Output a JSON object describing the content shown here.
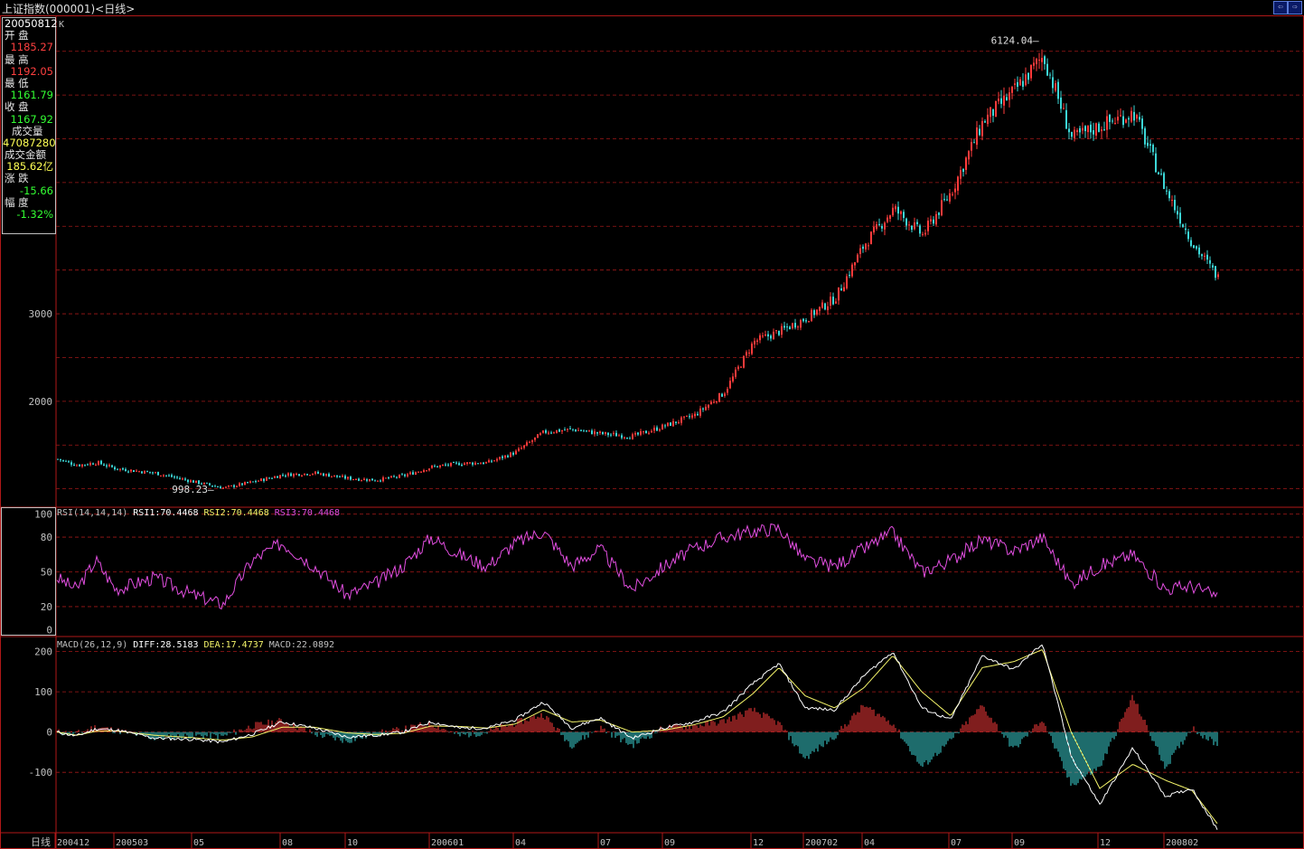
{
  "window": {
    "title": "上证指数(000001)<日线>",
    "buttons": [
      "⇦",
      "⇨"
    ]
  },
  "info": {
    "date": "20050812",
    "rows": [
      {
        "label": "开  盘",
        "value": "1185.27",
        "color": "#ff4040"
      },
      {
        "label": "最  高",
        "value": "1192.05",
        "color": "#ff4040"
      },
      {
        "label": "最  低",
        "value": "1161.79",
        "color": "#33ff33"
      },
      {
        "label": "收  盘",
        "value": "1167.92",
        "color": "#33ff33"
      },
      {
        "label": "成交量",
        "value": "47087280",
        "color": "#ffff55"
      },
      {
        "label": "成交金额",
        "value": "185.62亿",
        "color": "#ffff55"
      },
      {
        "label": "涨  跌",
        "value": "-15.66",
        "color": "#33ff33"
      },
      {
        "label": "幅  度",
        "value": "-1.32%",
        "color": "#33ff33"
      }
    ]
  },
  "colors": {
    "border": "#b01818",
    "grid": "#a01818",
    "up": "#ff3b3b",
    "down": "#3cd7d7",
    "rsi": "#e24ee0",
    "diff": "#ffffff",
    "dea": "#f5f56a",
    "text": "#c0c0c0"
  },
  "chart_data": [
    {
      "type": "candlestick",
      "panel": "main",
      "panel_label": "K",
      "y_ticks": [
        2000,
        3000
      ],
      "ylim": [
        800,
        6400
      ],
      "annotations": [
        {
          "text": "6124.04",
          "value": 6124.04,
          "date": "2007-10"
        },
        {
          "text": "998.23",
          "value": 998.23,
          "date": "2005-06"
        }
      ],
      "close_path": [
        {
          "date": "2004-12",
          "value": 1340
        },
        {
          "date": "2005-01",
          "value": 1270
        },
        {
          "date": "2005-02",
          "value": 1300
        },
        {
          "date": "2005-03",
          "value": 1230
        },
        {
          "date": "2005-04",
          "value": 1180
        },
        {
          "date": "2005-05",
          "value": 1080
        },
        {
          "date": "2005-06",
          "value": 1010
        },
        {
          "date": "2005-07",
          "value": 1080
        },
        {
          "date": "2005-08",
          "value": 1160
        },
        {
          "date": "2005-09",
          "value": 1180
        },
        {
          "date": "2005-10",
          "value": 1120
        },
        {
          "date": "2005-11",
          "value": 1100
        },
        {
          "date": "2005-12",
          "value": 1150
        },
        {
          "date": "2006-01",
          "value": 1250
        },
        {
          "date": "2006-02",
          "value": 1290
        },
        {
          "date": "2006-03",
          "value": 1300
        },
        {
          "date": "2006-04",
          "value": 1420
        },
        {
          "date": "2006-05",
          "value": 1650
        },
        {
          "date": "2006-06",
          "value": 1680
        },
        {
          "date": "2006-07",
          "value": 1630
        },
        {
          "date": "2006-08",
          "value": 1600
        },
        {
          "date": "2006-09",
          "value": 1720
        },
        {
          "date": "2006-10",
          "value": 1840
        },
        {
          "date": "2006-11",
          "value": 2100
        },
        {
          "date": "2006-12",
          "value": 2680
        },
        {
          "date": "2007-01",
          "value": 2800
        },
        {
          "date": "2007-02",
          "value": 2950
        },
        {
          "date": "2007-03",
          "value": 3180
        },
        {
          "date": "2007-04",
          "value": 3800
        },
        {
          "date": "2007-05",
          "value": 4200
        },
        {
          "date": "2007-06",
          "value": 3900
        },
        {
          "date": "2007-07",
          "value": 4400
        },
        {
          "date": "2007-08",
          "value": 5200
        },
        {
          "date": "2007-09",
          "value": 5550
        },
        {
          "date": "2007-10",
          "value": 5950
        },
        {
          "date": "2007-11",
          "value": 5000
        },
        {
          "date": "2007-12",
          "value": 5150
        },
        {
          "date": "2008-01",
          "value": 5300
        },
        {
          "date": "2008-02",
          "value": 4400
        },
        {
          "date": "2008-03",
          "value": 3800
        },
        {
          "date": "2008-04",
          "value": 3400
        }
      ]
    },
    {
      "type": "line",
      "panel": "rsi",
      "legend": [
        {
          "text": "RSI(14,14,14)",
          "color": "#c0c0c0"
        },
        {
          "text": "RSI1:70.4468",
          "color": "#ffffff"
        },
        {
          "text": "RSI2:70.4468",
          "color": "#f5f56a"
        },
        {
          "text": "RSI3:70.4468",
          "color": "#e24ee0"
        }
      ],
      "y_ticks": [
        100,
        80,
        50,
        20,
        0
      ],
      "ylim": [
        -5,
        105
      ],
      "series": [
        {
          "values": [
            {
              "date": "2004-12",
              "value": 45
            },
            {
              "date": "2005-01",
              "value": 35
            },
            {
              "date": "2005-02",
              "value": 60
            },
            {
              "date": "2005-03",
              "value": 35
            },
            {
              "date": "2005-04",
              "value": 45
            },
            {
              "date": "2005-05",
              "value": 30
            },
            {
              "date": "2005-06",
              "value": 22
            },
            {
              "date": "2005-07",
              "value": 60
            },
            {
              "date": "2005-08",
              "value": 75
            },
            {
              "date": "2005-09",
              "value": 55
            },
            {
              "date": "2005-10",
              "value": 30
            },
            {
              "date": "2005-11",
              "value": 40
            },
            {
              "date": "2005-12",
              "value": 55
            },
            {
              "date": "2006-01",
              "value": 80
            },
            {
              "date": "2006-02",
              "value": 65
            },
            {
              "date": "2006-03",
              "value": 55
            },
            {
              "date": "2006-04",
              "value": 75
            },
            {
              "date": "2006-05",
              "value": 85
            },
            {
              "date": "2006-06",
              "value": 55
            },
            {
              "date": "2006-07",
              "value": 70
            },
            {
              "date": "2006-08",
              "value": 35
            },
            {
              "date": "2006-09",
              "value": 55
            },
            {
              "date": "2006-10",
              "value": 70
            },
            {
              "date": "2006-11",
              "value": 80
            },
            {
              "date": "2006-12",
              "value": 85
            },
            {
              "date": "2007-01",
              "value": 88
            },
            {
              "date": "2007-02",
              "value": 60
            },
            {
              "date": "2007-03",
              "value": 55
            },
            {
              "date": "2007-04",
              "value": 70
            },
            {
              "date": "2007-05",
              "value": 84
            },
            {
              "date": "2007-06",
              "value": 50
            },
            {
              "date": "2007-07",
              "value": 60
            },
            {
              "date": "2007-08",
              "value": 78
            },
            {
              "date": "2007-09",
              "value": 68
            },
            {
              "date": "2007-10",
              "value": 80
            },
            {
              "date": "2007-11",
              "value": 40
            },
            {
              "date": "2007-12",
              "value": 55
            },
            {
              "date": "2008-01",
              "value": 65
            },
            {
              "date": "2008-02",
              "value": 35
            },
            {
              "date": "2008-03",
              "value": 38
            },
            {
              "date": "2008-04",
              "value": 28
            }
          ]
        }
      ]
    },
    {
      "type": "macd",
      "panel": "macd",
      "legend": [
        {
          "text": "MACD(26,12,9)",
          "color": "#c0c0c0"
        },
        {
          "text": "DIFF:28.5183",
          "color": "#ffffff"
        },
        {
          "text": "DEA:17.4737",
          "color": "#f5f56a"
        },
        {
          "text": "MACD:22.0892",
          "color": "#c0c0c0"
        }
      ],
      "y_ticks": [
        200,
        100,
        0,
        -100
      ],
      "ylim": [
        -250,
        235
      ],
      "series": [
        {
          "name": "DIFF",
          "values": [
            {
              "date": "2004-12",
              "value": 0
            },
            {
              "date": "2005-01",
              "value": -10
            },
            {
              "date": "2005-02",
              "value": 8
            },
            {
              "date": "2005-03",
              "value": 5
            },
            {
              "date": "2005-04",
              "value": -15
            },
            {
              "date": "2005-05",
              "value": -18
            },
            {
              "date": "2005-06",
              "value": -25
            },
            {
              "date": "2005-07",
              "value": -5
            },
            {
              "date": "2005-08",
              "value": 25
            },
            {
              "date": "2005-09",
              "value": 10
            },
            {
              "date": "2005-10",
              "value": -12
            },
            {
              "date": "2005-11",
              "value": -8
            },
            {
              "date": "2005-12",
              "value": 0
            },
            {
              "date": "2006-01",
              "value": 25
            },
            {
              "date": "2006-02",
              "value": 10
            },
            {
              "date": "2006-03",
              "value": 10
            },
            {
              "date": "2006-04",
              "value": 30
            },
            {
              "date": "2006-05",
              "value": 75
            },
            {
              "date": "2006-06",
              "value": 10
            },
            {
              "date": "2006-07",
              "value": 35
            },
            {
              "date": "2006-08",
              "value": -15
            },
            {
              "date": "2006-09",
              "value": 10
            },
            {
              "date": "2006-10",
              "value": 25
            },
            {
              "date": "2006-11",
              "value": 50
            },
            {
              "date": "2006-12",
              "value": 120
            },
            {
              "date": "2007-01",
              "value": 170
            },
            {
              "date": "2007-02",
              "value": 60
            },
            {
              "date": "2007-03",
              "value": 55
            },
            {
              "date": "2007-04",
              "value": 140
            },
            {
              "date": "2007-05",
              "value": 200
            },
            {
              "date": "2007-06",
              "value": 60
            },
            {
              "date": "2007-07",
              "value": 30
            },
            {
              "date": "2007-08",
              "value": 190
            },
            {
              "date": "2007-09",
              "value": 155
            },
            {
              "date": "2007-10",
              "value": 220
            },
            {
              "date": "2007-11",
              "value": -60
            },
            {
              "date": "2007-12",
              "value": -180
            },
            {
              "date": "2008-01",
              "value": -40
            },
            {
              "date": "2008-02",
              "value": -160
            },
            {
              "date": "2008-03",
              "value": -140
            },
            {
              "date": "2008-04",
              "value": -245
            }
          ]
        },
        {
          "name": "DEA",
          "values": [
            {
              "date": "2004-12",
              "value": 0
            },
            {
              "date": "2005-01",
              "value": -8
            },
            {
              "date": "2005-02",
              "value": 2
            },
            {
              "date": "2005-03",
              "value": 3
            },
            {
              "date": "2005-04",
              "value": -8
            },
            {
              "date": "2005-05",
              "value": -14
            },
            {
              "date": "2005-06",
              "value": -20
            },
            {
              "date": "2005-07",
              "value": -12
            },
            {
              "date": "2005-08",
              "value": 12
            },
            {
              "date": "2005-09",
              "value": 12
            },
            {
              "date": "2005-10",
              "value": -2
            },
            {
              "date": "2005-11",
              "value": -6
            },
            {
              "date": "2005-12",
              "value": -3
            },
            {
              "date": "2006-01",
              "value": 15
            },
            {
              "date": "2006-02",
              "value": 14
            },
            {
              "date": "2006-03",
              "value": 10
            },
            {
              "date": "2006-04",
              "value": 20
            },
            {
              "date": "2006-05",
              "value": 55
            },
            {
              "date": "2006-06",
              "value": 25
            },
            {
              "date": "2006-07",
              "value": 30
            },
            {
              "date": "2006-08",
              "value": 0
            },
            {
              "date": "2006-09",
              "value": 5
            },
            {
              "date": "2006-10",
              "value": 18
            },
            {
              "date": "2006-11",
              "value": 38
            },
            {
              "date": "2006-12",
              "value": 95
            },
            {
              "date": "2007-01",
              "value": 160
            },
            {
              "date": "2007-02",
              "value": 90
            },
            {
              "date": "2007-03",
              "value": 60
            },
            {
              "date": "2007-04",
              "value": 110
            },
            {
              "date": "2007-05",
              "value": 190
            },
            {
              "date": "2007-06",
              "value": 100
            },
            {
              "date": "2007-07",
              "value": 40
            },
            {
              "date": "2007-08",
              "value": 160
            },
            {
              "date": "2007-09",
              "value": 175
            },
            {
              "date": "2007-10",
              "value": 205
            },
            {
              "date": "2007-11",
              "value": 0
            },
            {
              "date": "2007-12",
              "value": -140
            },
            {
              "date": "2008-01",
              "value": -80
            },
            {
              "date": "2008-02",
              "value": -120
            },
            {
              "date": "2008-03",
              "value": -145
            },
            {
              "date": "2008-04",
              "value": -230
            }
          ]
        }
      ]
    }
  ],
  "x_axis": {
    "title": "日线",
    "ticks": [
      {
        "label": "200412",
        "date": "2004-12"
      },
      {
        "label": "200503",
        "date": "2005-03"
      },
      {
        "label": "05",
        "date": "2005-05"
      },
      {
        "label": "08",
        "date": "2005-08"
      },
      {
        "label": "10",
        "date": "2005-10"
      },
      {
        "label": "200601",
        "date": "2006-01"
      },
      {
        "label": "04",
        "date": "2006-04"
      },
      {
        "label": "07",
        "date": "2006-07"
      },
      {
        "label": "09",
        "date": "2006-09"
      },
      {
        "label": "12",
        "date": "2006-12"
      },
      {
        "label": "200702",
        "date": "2007-02"
      },
      {
        "label": "04",
        "date": "2007-04"
      },
      {
        "label": "07",
        "date": "2007-07"
      },
      {
        "label": "09",
        "date": "2007-09"
      },
      {
        "label": "12",
        "date": "2007-12"
      },
      {
        "label": "200802",
        "date": "2008-02"
      }
    ]
  }
}
